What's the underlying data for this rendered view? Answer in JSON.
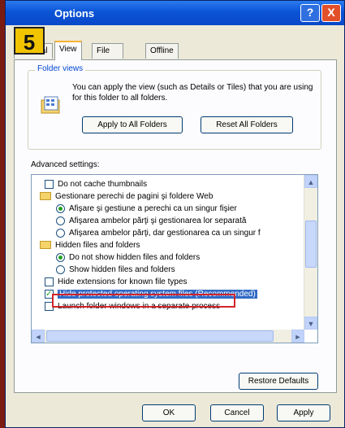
{
  "step_badge": "5",
  "window": {
    "title": "Options",
    "help_glyph": "?",
    "close_glyph": "X"
  },
  "tabs": [
    {
      "label": "General",
      "active": false
    },
    {
      "label": "View",
      "active": true
    },
    {
      "label": "File Types",
      "active": false
    },
    {
      "label": "Offline Files",
      "active": false
    }
  ],
  "folder_views": {
    "legend": "Folder views",
    "description": "You can apply the view (such as Details or Tiles) that you are using for this folder to all folders.",
    "apply_button": "Apply to All Folders",
    "reset_button": "Reset All Folders"
  },
  "advanced": {
    "label": "Advanced settings:",
    "items": [
      {
        "kind": "checkbox",
        "checked": false,
        "indent": 0,
        "text": "Do not cache thumbnails"
      },
      {
        "kind": "folder",
        "indent": 0,
        "text": "Gestionare perechi de pagini şi foldere Web"
      },
      {
        "kind": "radio",
        "checked": true,
        "indent": 1,
        "text": "Afişare şi gestiune a perechi ca un singur fişier"
      },
      {
        "kind": "radio",
        "checked": false,
        "indent": 1,
        "text": "Afişarea ambelor părţi şi gestionarea lor separată"
      },
      {
        "kind": "radio",
        "checked": false,
        "indent": 1,
        "text": "Afişarea ambelor părţi, dar gestionarea ca un singur f"
      },
      {
        "kind": "folder",
        "indent": 0,
        "text": "Hidden files and folders"
      },
      {
        "kind": "radio",
        "checked": true,
        "indent": 1,
        "text": "Do not show hidden files and folders"
      },
      {
        "kind": "radio",
        "checked": false,
        "indent": 1,
        "text": "Show hidden files and folders"
      },
      {
        "kind": "checkbox",
        "checked": false,
        "indent": 0,
        "text": "Hide extensions for known file types",
        "highlighted": true
      },
      {
        "kind": "checkbox",
        "checked": true,
        "indent": 0,
        "text": "Hide protected operating system files (Recommended)",
        "selected": true
      },
      {
        "kind": "checkbox",
        "checked": false,
        "indent": 0,
        "text": "Launch folder windows in a separate process"
      }
    ]
  },
  "scroll_glyphs": {
    "up": "▲",
    "down": "▼",
    "left": "◄",
    "right": "►"
  },
  "restore_button": "Restore Defaults",
  "footer": {
    "ok": "OK",
    "cancel": "Cancel",
    "apply": "Apply"
  },
  "colors": {
    "background": "#7a1c12",
    "titlebar": "#0b54d6",
    "badge": "#f2c400",
    "highlight_border": "#d2232a",
    "selection": "#316ac5"
  }
}
